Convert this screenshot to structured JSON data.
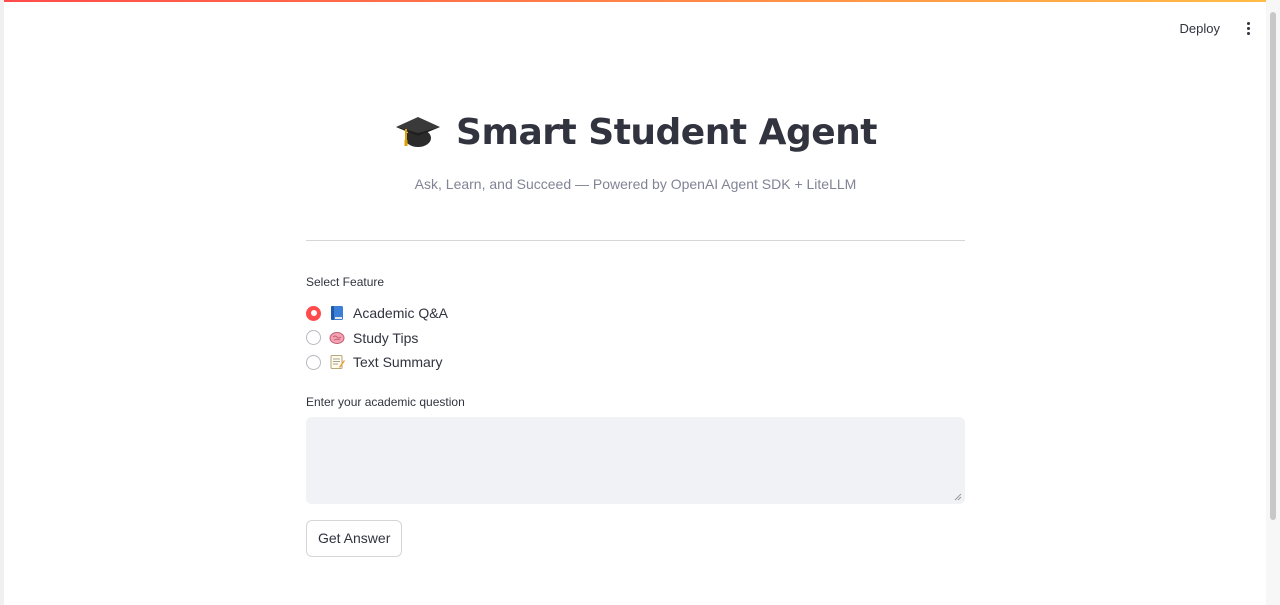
{
  "header": {
    "deploy_label": "Deploy"
  },
  "app": {
    "title": "Smart Student Agent",
    "subtitle": "Ask, Learn, and Succeed — Powered by OpenAI Agent SDK + LiteLLM",
    "title_icon": "graduation-cap-icon"
  },
  "feature": {
    "label": "Select Feature",
    "options": [
      {
        "label": "Academic Q&A",
        "icon": "blue-book-icon",
        "selected": true
      },
      {
        "label": "Study Tips",
        "icon": "brain-icon",
        "selected": false
      },
      {
        "label": "Text Summary",
        "icon": "memo-icon",
        "selected": false
      }
    ]
  },
  "question": {
    "label": "Enter your academic question",
    "value": "",
    "placeholder": ""
  },
  "actions": {
    "submit_label": "Get Answer"
  },
  "colors": {
    "accent": "#ff4b4b",
    "text": "#31333f",
    "muted": "#808495",
    "input_bg": "#f0f2f6"
  }
}
